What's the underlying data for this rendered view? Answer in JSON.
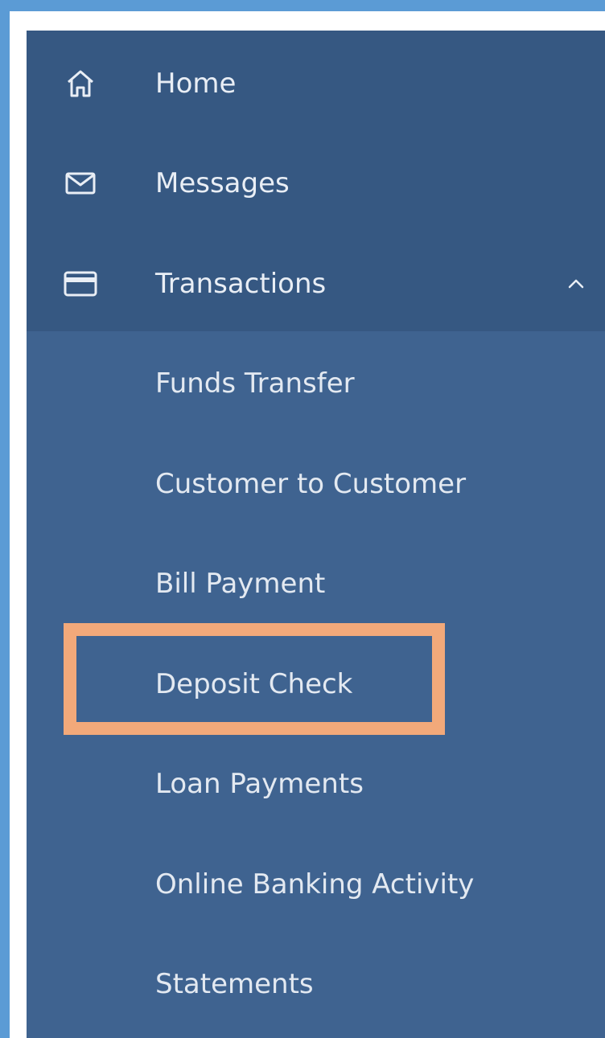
{
  "nav": {
    "home_label": "Home",
    "messages_label": "Messages",
    "transactions_label": "Transactions"
  },
  "submenu": [
    {
      "label": "Funds Transfer"
    },
    {
      "label": "Customer to Customer"
    },
    {
      "label": "Bill Payment"
    },
    {
      "label": "Deposit Check"
    },
    {
      "label": "Loan Payments"
    },
    {
      "label": "Online Banking Activity"
    },
    {
      "label": "Statements"
    }
  ],
  "colors": {
    "background_frame": "#5b9bd5",
    "sidebar_top": "#365882",
    "sidebar_sub": "#3f6390",
    "highlight": "#f2a97a",
    "text": "#e9eef5"
  },
  "icons": {
    "home": "home-icon",
    "messages": "envelope-icon",
    "transactions": "card-icon",
    "expand": "chevron-up-icon"
  }
}
